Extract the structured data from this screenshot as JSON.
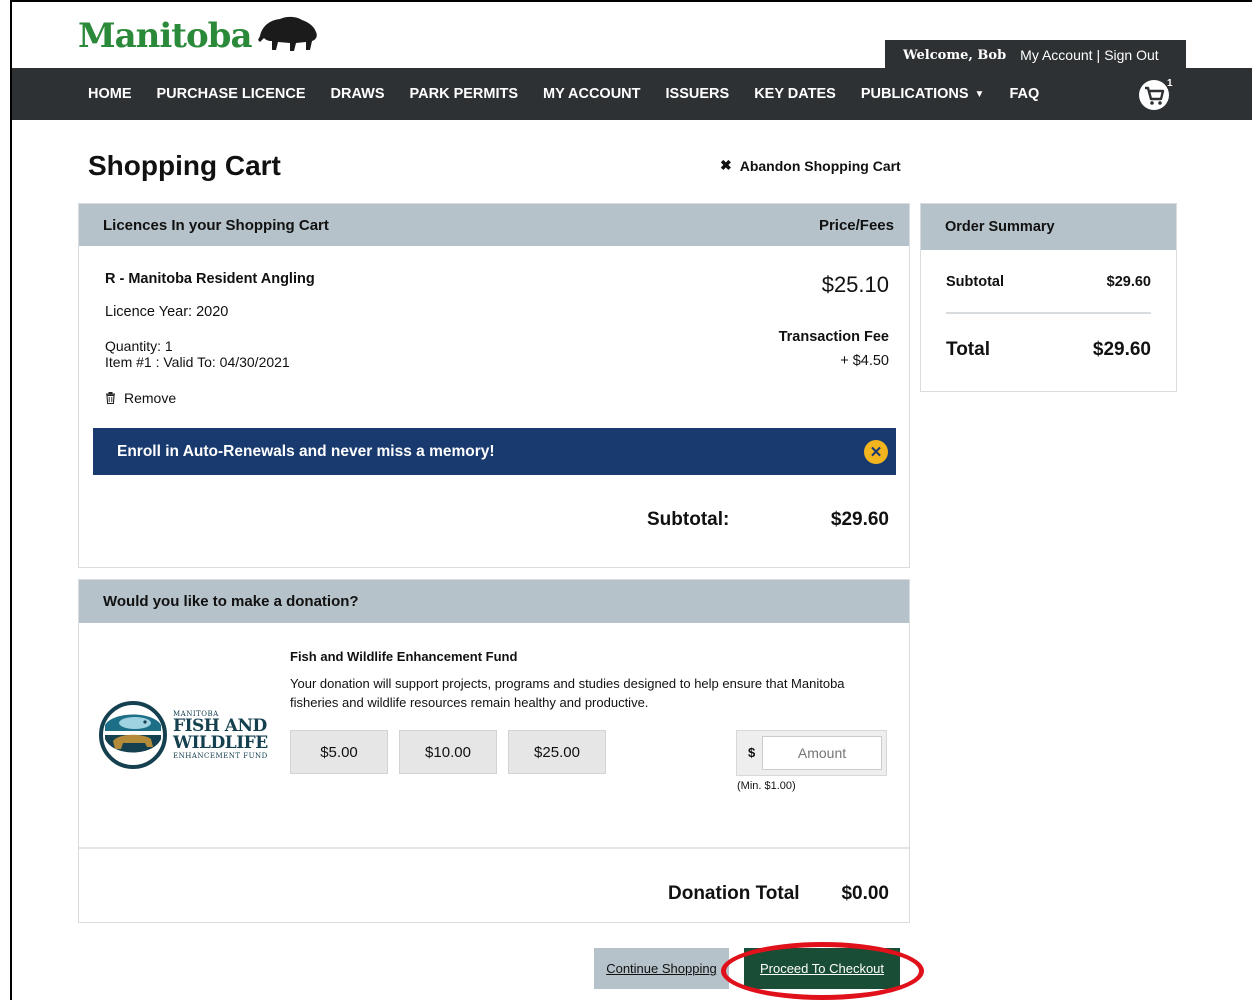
{
  "header": {
    "logo_text": "Manitoba",
    "welcome": "Welcome, Bob",
    "my_account": "My Account",
    "separator": "|",
    "sign_out": "Sign Out",
    "cart_count": "1"
  },
  "nav": {
    "items": [
      "HOME",
      "PURCHASE LICENCE",
      "DRAWS",
      "PARK PERMITS",
      "MY ACCOUNT",
      "ISSUERS",
      "KEY DATES",
      "PUBLICATIONS",
      "FAQ"
    ]
  },
  "page": {
    "title": "Shopping Cart",
    "abandon": "Abandon Shopping Cart"
  },
  "cart": {
    "header_left": "Licences In your Shopping Cart",
    "header_right": "Price/Fees",
    "item": {
      "name": "R - Manitoba Resident Angling",
      "price": "$25.10",
      "year": "Licence Year: 2020",
      "quantity": "Quantity: 1",
      "valid": "Item #1 : Valid To: 04/30/2021",
      "fee_label": "Transaction Fee",
      "fee_value": "+ $4.50",
      "remove": "Remove"
    },
    "banner": "Enroll in Auto-Renewals and never miss a memory!",
    "subtotal_label": "Subtotal:",
    "subtotal_value": "$29.60"
  },
  "summary": {
    "title": "Order Summary",
    "subtotal_label": "Subtotal",
    "subtotal_value": "$29.60",
    "total_label": "Total",
    "total_value": "$29.60"
  },
  "donation": {
    "header": "Would you like to make a donation?",
    "logo": {
      "line1": "MANITOBA",
      "line2": "FISH AND",
      "line3": "WILDLIFE",
      "line4": "ENHANCEMENT FUND"
    },
    "fund_title": "Fish and Wildlife Enhancement Fund",
    "fund_desc": "Your donation will support projects, programs and studies designed to help ensure that Manitoba fisheries and wildlife resources remain healthy and productive.",
    "amounts": [
      "$5.00",
      "$10.00",
      "$25.00"
    ],
    "currency_symbol": "$",
    "amount_placeholder": "Amount",
    "min_note": "(Min. $1.00)",
    "total_label": "Donation Total",
    "total_value": "$0.00"
  },
  "actions": {
    "continue": "Continue Shopping",
    "checkout": "Proceed To Checkout"
  },
  "colors": {
    "nav_bg": "#2d3133",
    "panel_head": "#b5c2c9",
    "banner": "#193a6e",
    "checkout": "#1a4d36",
    "highlight": "#e0111b",
    "logo_green": "#2a8a3a"
  }
}
